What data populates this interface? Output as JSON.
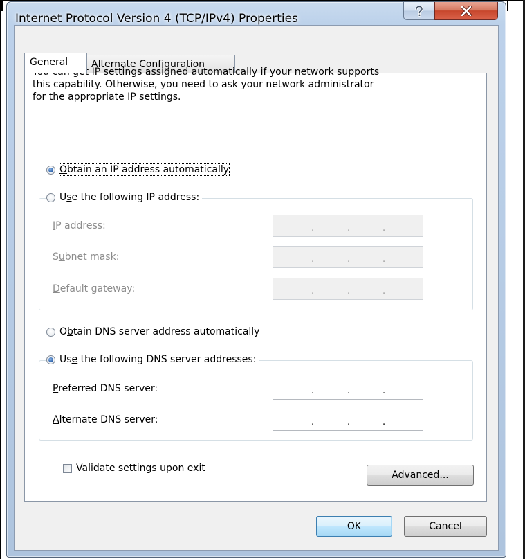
{
  "window": {
    "title": "Internet Protocol Version 4 (TCP/IPv4) Properties",
    "help_icon": "question-mark-icon",
    "close_icon": "close-x-icon"
  },
  "tabs": [
    {
      "label": "General",
      "selected": true
    },
    {
      "label": "Alternate Configuration",
      "selected": false
    }
  ],
  "intro_text": "You can get IP settings assigned automatically if your network supports\nthis capability. Otherwise, you need to ask your network administrator\nfor the appropriate IP settings.",
  "ip_mode": {
    "auto": {
      "pre": "",
      "key": "O",
      "post": "btain an IP address automatically",
      "checked": true
    },
    "manual": {
      "pre": "U",
      "key": "s",
      "post": "e the following IP address:",
      "checked": false
    }
  },
  "ip_fields": [
    {
      "pre": "",
      "key": "I",
      "post": "P address:",
      "value": ". . .",
      "disabled": true
    },
    {
      "pre": "S",
      "key": "u",
      "post": "bnet mask:",
      "value": ". . .",
      "disabled": true
    },
    {
      "pre": "",
      "key": "D",
      "post": "efault gateway:",
      "value": ". . .",
      "disabled": true
    }
  ],
  "dns_mode": {
    "auto": {
      "pre": "O",
      "key": "b",
      "post": "tain DNS server address automatically",
      "checked": false
    },
    "manual": {
      "pre": "Us",
      "key": "e",
      "post": " the following DNS server addresses:",
      "checked": true
    }
  },
  "dns_fields": [
    {
      "pre": "",
      "key": "P",
      "post": "referred DNS server:",
      "value": ". . ."
    },
    {
      "pre": "",
      "key": "A",
      "post": "lternate DNS server:",
      "value": ". . ."
    }
  ],
  "validate": {
    "pre": "Va",
    "key": "l",
    "post": "idate settings upon exit",
    "checked": false
  },
  "buttons": {
    "advanced": {
      "pre": "Ad",
      "key": "v",
      "post": "anced..."
    },
    "ok": "OK",
    "cancel": "Cancel"
  },
  "colors": {
    "frame": "#b8cde6",
    "client": "#f0f0f0",
    "close_button": "#c7462c",
    "radio_selected": "#2a5fa8",
    "disabled_text": "#8c8c8c"
  }
}
